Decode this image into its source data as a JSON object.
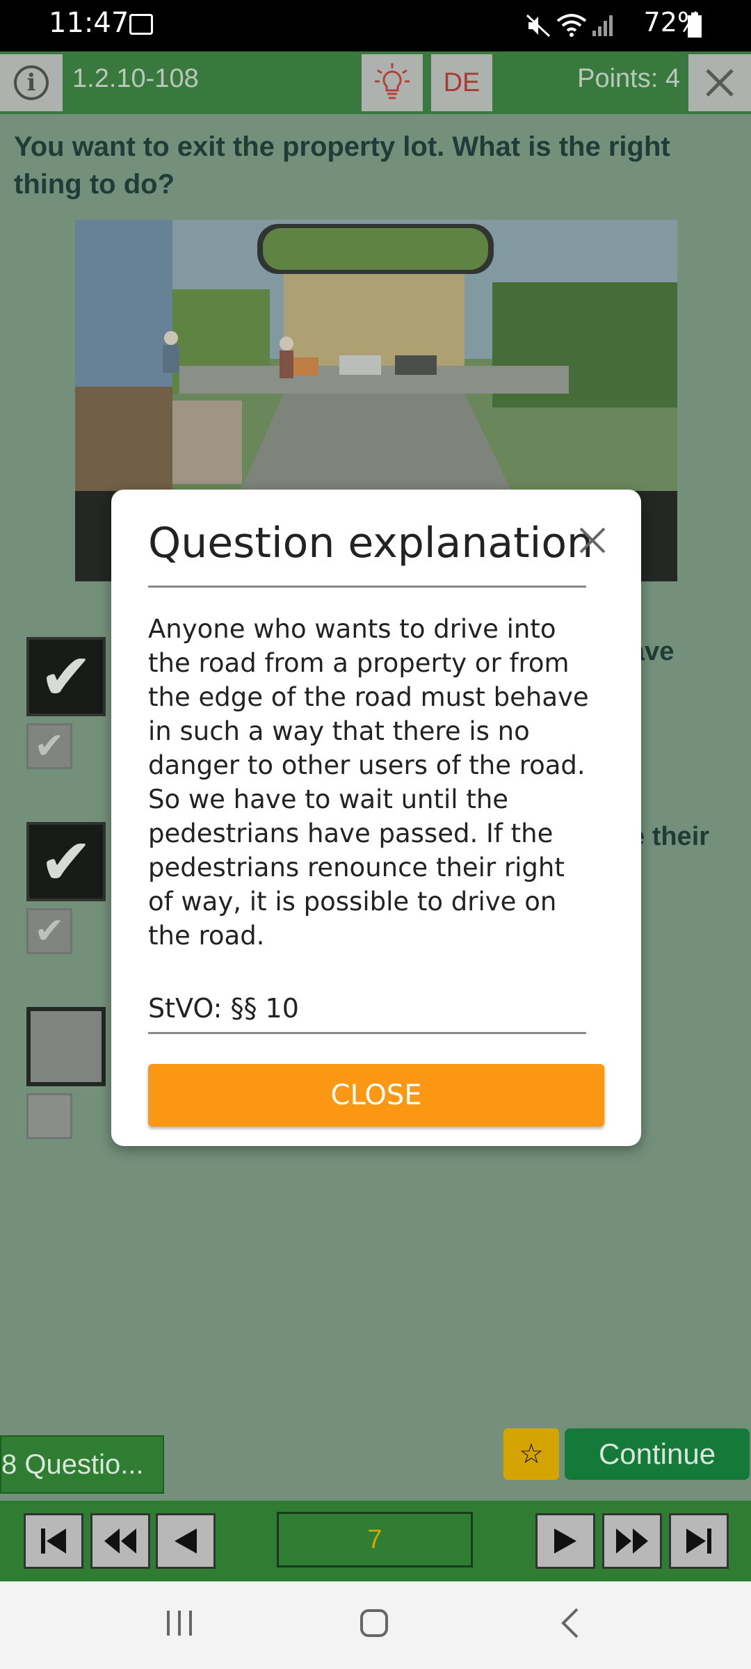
{
  "status_bar": {
    "time": "11:47",
    "battery": "72%",
    "icons": [
      "image-icon",
      "mute-icon",
      "wifi-icon",
      "signal-icon",
      "battery-icon"
    ]
  },
  "header": {
    "question_id": "1.2.10-108",
    "language": "DE",
    "points": "Points: 4",
    "icons": [
      "info-icon",
      "lightbulb-icon",
      "close-icon"
    ]
  },
  "question": {
    "text": "You want to exit the property lot. What is the right thing to do?"
  },
  "answers": [
    {
      "text_fragment": "ave",
      "checked": true,
      "correct": true
    },
    {
      "text_fragment": "e their",
      "checked": true,
      "correct": true
    },
    {
      "text_fragment": "",
      "checked": false,
      "correct": false
    }
  ],
  "dialog": {
    "title": "Question explanation",
    "body": "Anyone who wants to drive into the road from a property or from the edge of the road must behave in such a way that there is no danger to other users of the road. So we have to wait until the pedestrians have passed. If the pedestrians renounce their right of way, it is possible to drive on the road.",
    "reference": "StVO: §§ 10",
    "close_label": "CLOSE"
  },
  "footer": {
    "question_count": "8 Questio...",
    "continue_label": "Continue",
    "star_icon": "star-icon",
    "page_number": "7"
  },
  "colors": {
    "header_green": "#2e7d32",
    "background": "#7d9b85",
    "close_button": "#fb9712",
    "continue_button": "#137a3a",
    "star_button": "#d6a400"
  }
}
